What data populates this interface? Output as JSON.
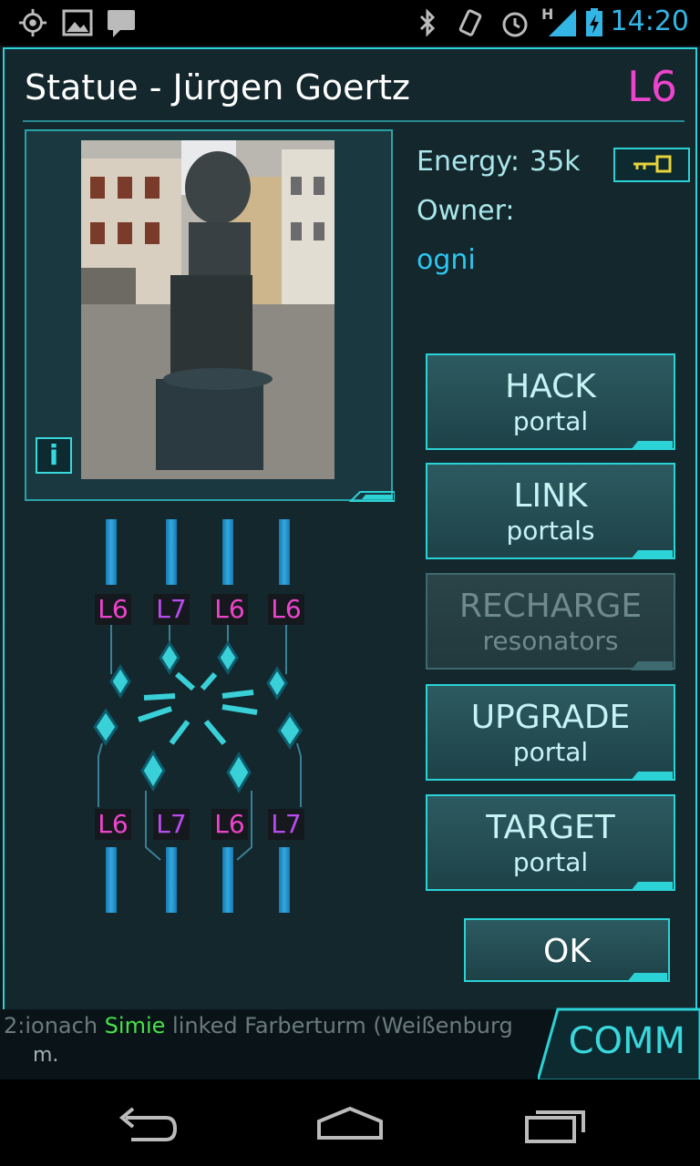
{
  "status_bar": {
    "time": "14:20",
    "left_icons": [
      "gps-icon",
      "picture-icon",
      "chat-icon"
    ],
    "right_icons": [
      "bluetooth-icon",
      "vibrate-icon",
      "alarm-icon",
      "signal-icon",
      "battery-charging-icon"
    ],
    "network_type": "H"
  },
  "dialog": {
    "title": "Statue - Jürgen Goertz",
    "level": "L6",
    "info_button": "i",
    "energy_label": "Energy:",
    "energy_value": "35k",
    "owner_label": "Owner:",
    "owner_name": "ogni",
    "key_icon": "key-icon"
  },
  "resonators": {
    "top_labels": [
      "L6",
      "L7",
      "L6",
      "L6"
    ],
    "bottom_labels": [
      "L6",
      "L7",
      "L6",
      "L7"
    ]
  },
  "actions": [
    {
      "main": "HACK",
      "sub": "portal",
      "enabled": true
    },
    {
      "main": "LINK",
      "sub": "portals",
      "enabled": true
    },
    {
      "main": "RECHARGE",
      "sub": "resonators",
      "enabled": false
    },
    {
      "main": "UPGRADE",
      "sub": "portal",
      "enabled": true
    },
    {
      "main": "TARGET",
      "sub": "portal",
      "enabled": true
    }
  ],
  "ok_label": "OK",
  "comm": {
    "tab_label": "COMM",
    "line1_prefix": "2:ionach ",
    "line1_agent": "Simie",
    "line1_text": " linked Farberturm (Weißenburg",
    "line2": "m."
  },
  "colors": {
    "accent": "#2bd2d6",
    "level_magenta": "#ee44cc",
    "level_purple": "#b94bf0",
    "owner_blue": "#2ec6f0",
    "agent_green": "#48e04a"
  }
}
